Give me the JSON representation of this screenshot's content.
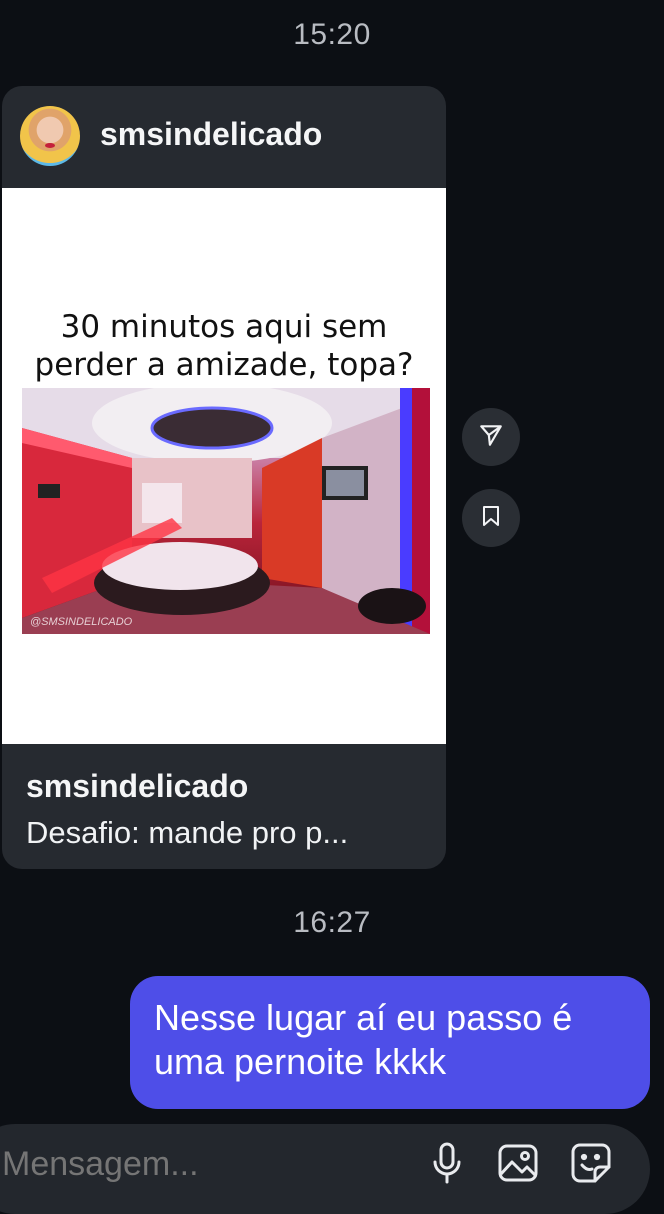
{
  "chat": {
    "timestamps": [
      "15:20",
      "16:27"
    ],
    "shared_post": {
      "username": "smsindelicado",
      "headline_line1": "30 minutos aqui sem",
      "headline_line2": "perder a amizade, topa?",
      "watermark": "@SMSINDELICADO",
      "footer_username": "smsindelicado",
      "caption": "Desafio: mande pro p..."
    },
    "side_actions": {
      "share_icon": "send-icon",
      "save_icon": "bookmark-icon"
    },
    "outgoing_message": {
      "line1": "Nesse lugar aí eu passo é",
      "line2": "uma pernoite kkkk"
    }
  },
  "composer": {
    "placeholder": "Mensagem...",
    "icons": [
      "microphone-icon",
      "gallery-icon",
      "sticker-icon"
    ]
  },
  "colors": {
    "background": "#0c0f14",
    "card": "#262a30",
    "outgoing_bubble": "#4e4ee8",
    "timestamp": "#b9bcc2"
  }
}
